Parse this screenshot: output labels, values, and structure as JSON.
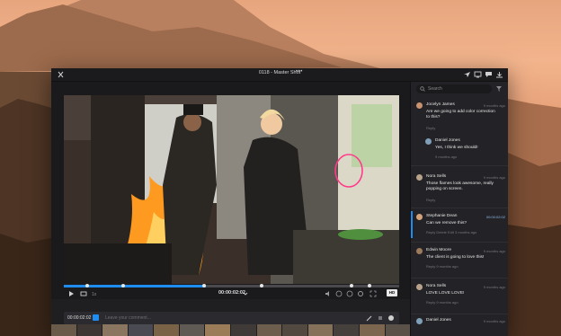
{
  "topbar": {
    "title": "0118 - Master Shot",
    "more": "•••"
  },
  "player": {
    "timecode": "00:00:02:02",
    "hd_label": "HD"
  },
  "comment_input": {
    "timecode": "00:00:02:02",
    "placeholder": "Leave your comment..."
  },
  "sidebar": {
    "search_placeholder": "Search",
    "comments": [
      {
        "name": "Jocelyn James",
        "time": "9 months ago",
        "text": "Are we going to add color correction to this?",
        "meta": "Reply"
      },
      {
        "name": "Daniel Jones",
        "time": "",
        "text": "Yes, I think we should!",
        "meta": "9 months ago"
      },
      {
        "name": "Nora Sells",
        "time": "9 months ago",
        "text": "Those flames look awesome, really popping on screen.",
        "meta": "Reply"
      },
      {
        "name": "Stephanie Dean",
        "time": "00:00:02:02",
        "text": "Can we remove this?",
        "meta": "Reply   Delete   Edit   3 months ago"
      },
      {
        "name": "Edwin Moore",
        "time": "9 months ago",
        "text": "The client is going to love this!",
        "meta": "Reply   9 months ago"
      },
      {
        "name": "Nora Sells",
        "time": "9 months ago",
        "text": "LOVE LOVE LOVE!",
        "meta": "Reply   9 months ago"
      },
      {
        "name": "Daniel Jones",
        "time": "9 months ago",
        "text": "",
        "meta": ""
      }
    ]
  },
  "colors": {
    "accent": "#1f8cf0",
    "annotation": "#ff3b8a"
  }
}
